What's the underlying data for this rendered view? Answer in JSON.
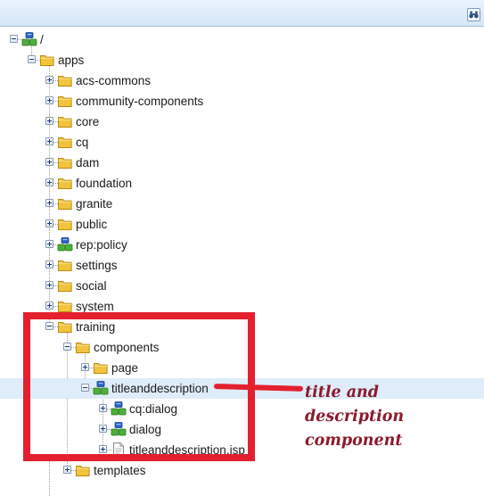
{
  "toolbar": {
    "find_icon": "binoculars-icon"
  },
  "tree": {
    "nodes": [
      {
        "key": "root",
        "label": "/",
        "level": 0,
        "toggle": "minus",
        "icon": "node"
      },
      {
        "key": "apps",
        "label": "apps",
        "level": 1,
        "toggle": "minus",
        "icon": "folder"
      },
      {
        "key": "acs-commons",
        "label": "acs-commons",
        "level": 2,
        "toggle": "plus",
        "icon": "folder"
      },
      {
        "key": "community-components",
        "label": "community-components",
        "level": 2,
        "toggle": "plus",
        "icon": "folder"
      },
      {
        "key": "core",
        "label": "core",
        "level": 2,
        "toggle": "plus",
        "icon": "folder"
      },
      {
        "key": "cq",
        "label": "cq",
        "level": 2,
        "toggle": "plus",
        "icon": "folder"
      },
      {
        "key": "dam",
        "label": "dam",
        "level": 2,
        "toggle": "plus",
        "icon": "folder"
      },
      {
        "key": "foundation",
        "label": "foundation",
        "level": 2,
        "toggle": "plus",
        "icon": "folder"
      },
      {
        "key": "granite",
        "label": "granite",
        "level": 2,
        "toggle": "plus",
        "icon": "folder"
      },
      {
        "key": "public",
        "label": "public",
        "level": 2,
        "toggle": "plus",
        "icon": "folder"
      },
      {
        "key": "rep-policy",
        "label": "rep:policy",
        "level": 2,
        "toggle": "plus",
        "icon": "node"
      },
      {
        "key": "settings",
        "label": "settings",
        "level": 2,
        "toggle": "plus",
        "icon": "folder"
      },
      {
        "key": "social",
        "label": "social",
        "level": 2,
        "toggle": "plus",
        "icon": "folder"
      },
      {
        "key": "system",
        "label": "system",
        "level": 2,
        "toggle": "plus",
        "icon": "folder"
      },
      {
        "key": "training",
        "label": "training",
        "level": 2,
        "toggle": "minus",
        "icon": "folder"
      },
      {
        "key": "components",
        "label": "components",
        "level": 3,
        "toggle": "minus",
        "icon": "folder"
      },
      {
        "key": "page",
        "label": "page",
        "level": 4,
        "toggle": "plus",
        "icon": "folder"
      },
      {
        "key": "titleanddescription",
        "label": "titleanddescription",
        "level": 4,
        "toggle": "minus",
        "icon": "node",
        "selected": true
      },
      {
        "key": "cq-dialog",
        "label": "cq:dialog",
        "level": 5,
        "toggle": "plus",
        "icon": "node"
      },
      {
        "key": "dialog",
        "label": "dialog",
        "level": 5,
        "toggle": "plus",
        "icon": "node"
      },
      {
        "key": "titleanddescription-jsp",
        "label": "titleanddescription.jsp",
        "level": 5,
        "toggle": "plus",
        "icon": "file"
      },
      {
        "key": "templates",
        "label": "templates",
        "level": 3,
        "toggle": "plus",
        "icon": "folder"
      }
    ]
  },
  "annotation": {
    "text": "title and\ndescription\ncomponent",
    "color": "#8b1a2b"
  },
  "colors": {
    "highlight": "#e4202e",
    "selected_row": "#dfecfa",
    "folder": "#f2c33d",
    "node_green": "#4caf3a",
    "node_blue": "#2a63c7"
  }
}
